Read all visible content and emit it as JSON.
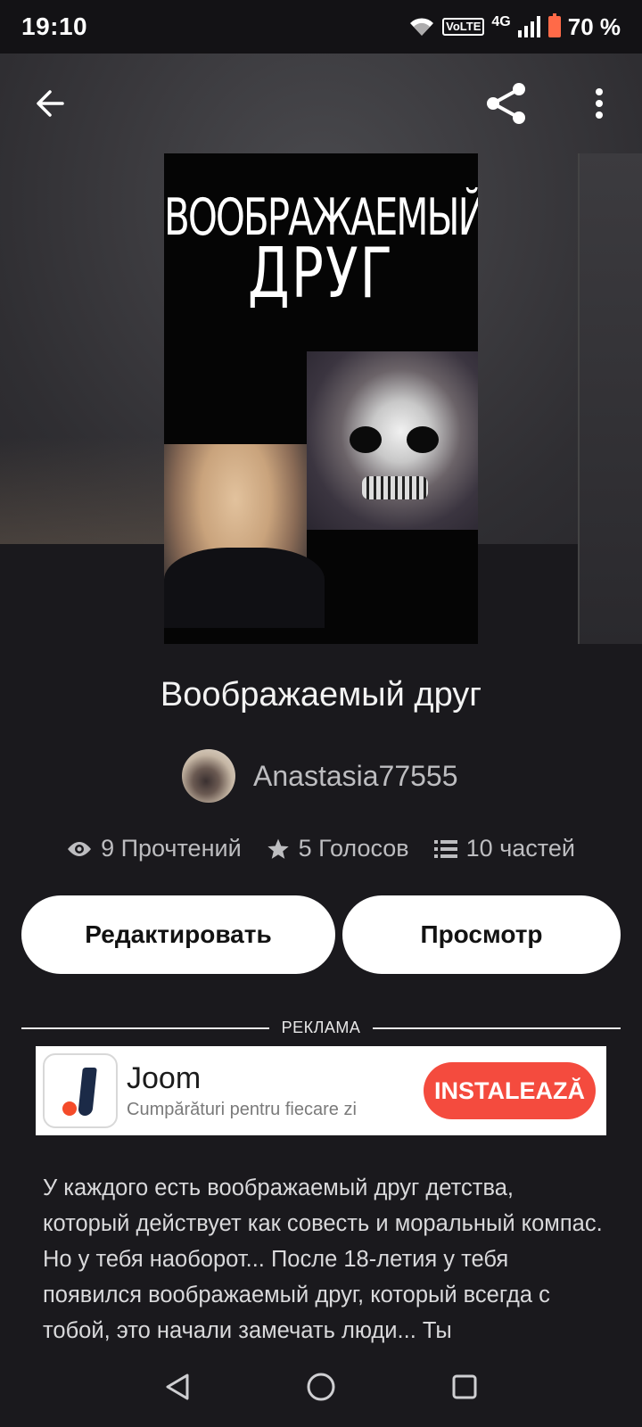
{
  "status_bar": {
    "time": "19:10",
    "volte": "VoLTE",
    "network": "4G",
    "battery": "70 %"
  },
  "toolbar": {
    "back_icon": "arrow-left-icon",
    "share_icon": "share-icon",
    "menu_icon": "more-vertical-icon"
  },
  "cover": {
    "line1": "ВООБРАЖАЕМЫЙ",
    "line2": "ДРУГ"
  },
  "book": {
    "title": "Воображаемый друг",
    "author": "Anastasia77555"
  },
  "stats": {
    "reads": "9 Прочтений",
    "votes": "5 Голосов",
    "parts": "10 частей"
  },
  "actions": {
    "edit": "Редактировать",
    "view": "Просмотр"
  },
  "ad": {
    "label": "РЕКЛАМА",
    "name": "Joom",
    "subtitle": "Cumpărături pentru fiecare zi",
    "cta": "INSTALEAZĂ",
    "cta_color": "#f44b3e"
  },
  "description": "У каждого есть воображаемый друг детства, который действует как совесть и моральный компас.  Но у тебя наоборот... После 18-летия у тебя появился воображаемый друг, который всегда с тобой, это начали замечать люди... Ты",
  "navbar": {
    "back": "triangle-back-icon",
    "home": "circle-home-icon",
    "recents": "square-recents-icon"
  }
}
